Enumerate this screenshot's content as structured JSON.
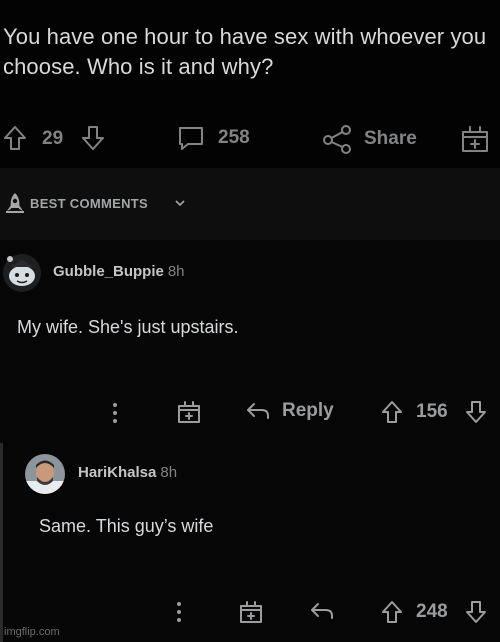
{
  "post": {
    "title": "You have one hour to have sex with whoever you choose. Who is it and why?",
    "upvotes": "29",
    "comments_count": "258",
    "share_label": "Share"
  },
  "sort": {
    "label": "BEST COMMENTS"
  },
  "comments": [
    {
      "username": "Gubble_Buppie",
      "age": "8h",
      "body": "My wife.  She's just upstairs.",
      "reply_label": "Reply",
      "score": "156"
    },
    {
      "username": "HariKhalsa",
      "age": "8h",
      "body": "Same. This guy’s wife",
      "score": "248"
    }
  ],
  "watermark": "imgflip.com",
  "colors": {
    "background": "#000000",
    "text": "#d7dadc",
    "muted": "#818384"
  }
}
